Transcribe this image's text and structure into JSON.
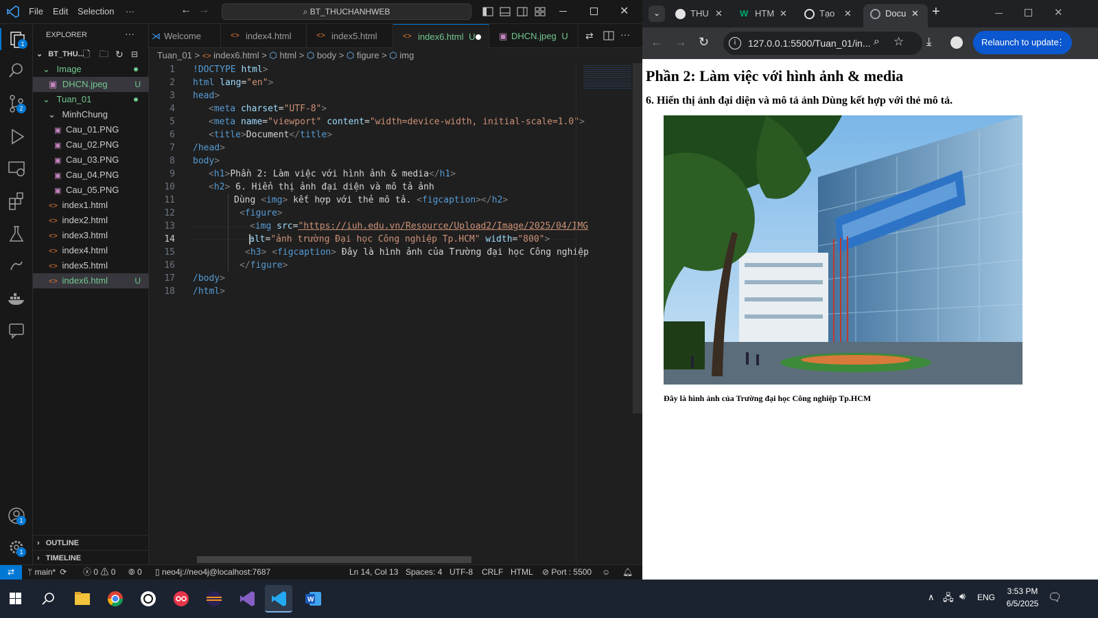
{
  "vscode": {
    "menu": [
      "File",
      "Edit",
      "Selection",
      "···"
    ],
    "command_center": "BT_THUCHANHWEB",
    "badges": {
      "explorer": "1",
      "source_control": "2",
      "accounts": "1",
      "manage": "1"
    },
    "explorer": {
      "title": "EXPLORER",
      "more": "···",
      "root": "BT_THU...",
      "items": [
        {
          "label": "Image",
          "status": ""
        },
        {
          "label": "DHCN.jpeg",
          "status": "U"
        },
        {
          "label": "Tuan_01",
          "status": ""
        },
        {
          "label": "MinhChung",
          "status": ""
        },
        {
          "label": "Cau_01.PNG",
          "status": ""
        },
        {
          "label": "Cau_02.PNG",
          "status": ""
        },
        {
          "label": "Cau_03.PNG",
          "status": ""
        },
        {
          "label": "Cau_04.PNG",
          "status": ""
        },
        {
          "label": "Cau_05.PNG",
          "status": ""
        },
        {
          "label": "index1.html",
          "status": ""
        },
        {
          "label": "index2.html",
          "status": ""
        },
        {
          "label": "index3.html",
          "status": ""
        },
        {
          "label": "index4.html",
          "status": ""
        },
        {
          "label": "index5.html",
          "status": ""
        },
        {
          "label": "index6.html",
          "status": "U"
        }
      ],
      "outline": "OUTLINE",
      "timeline": "TIMELINE"
    },
    "tabs": [
      {
        "label": "Welcome",
        "status": ""
      },
      {
        "label": "index4.html",
        "status": ""
      },
      {
        "label": "index5.html",
        "status": ""
      },
      {
        "label": "index6.html",
        "status": "U"
      },
      {
        "label": "DHCN.jpeg",
        "status": "U"
      }
    ],
    "breadcrumbs": [
      "Tuan_01",
      ">",
      "index6.html",
      ">",
      "html",
      ">",
      "body",
      ">",
      "figure",
      ">",
      "img"
    ],
    "code": {
      "line_numbers": [
        "1",
        "2",
        "3",
        "4",
        "5",
        "6",
        "7",
        "8",
        "9",
        "10",
        "11",
        "12",
        "13",
        "14",
        "15",
        "16",
        "17",
        "18"
      ],
      "current_line": "14",
      "l1_a": "!DOCTYPE",
      "l1_b": " html",
      "l1_c": ">",
      "l2_a": "html",
      "l2_b": " lang",
      "l2_c": "=",
      "l2_d": "\"en\"",
      "l2_e": ">",
      "l3_a": "head",
      "l3_b": ">",
      "l4_a": "<",
      "l4_b": "meta",
      "l4_c": " charset",
      "l4_d": "=",
      "l4_e": "\"UTF-8\"",
      "l4_f": ">",
      "l5_a": "<",
      "l5_b": "meta",
      "l5_c": " name",
      "l5_d": "=",
      "l5_e": "\"viewport\"",
      "l5_f": " content",
      "l5_g": "=",
      "l5_h": "\"width=device-width, initial-scale=1.0\"",
      "l5_i": ">",
      "l6_a": "<",
      "l6_b": "title",
      "l6_c": ">",
      "l6_d": "Document",
      "l6_e": "</",
      "l6_f": "title",
      "l6_g": ">",
      "l7_a": "/head",
      "l7_b": ">",
      "l8_a": "body",
      "l8_b": ">",
      "l9_a": "<",
      "l9_b": "h1",
      "l9_c": ">",
      "l9_d": "Phần 2: Làm việc với hình ảnh & media",
      "l9_e": "</",
      "l9_f": "h1",
      "l9_g": ">",
      "l10_a": "<",
      "l10_b": "h2",
      "l10_c": ">",
      "l10_d": " 6. Hiển thị ảnh đại diện và mô tả ảnh",
      "l11_a": "Dùng ",
      "l11_b": "<",
      "l11_c": "img",
      "l11_d": ">",
      "l11_e": " kết hợp với thẻ mô tả. ",
      "l11_f": "<",
      "l11_g": "figcaption",
      "l11_h": "></",
      "l11_i": "h2",
      "l11_j": ">",
      "l12_a": "<",
      "l12_b": "figure",
      "l12_c": ">",
      "l13_a": "<",
      "l13_b": "img",
      "l13_c": " src",
      "l13_d": "=",
      "l13_e": "\"https://iuh.edu.vn/Resource/Upload2/Image/2025/04/IMG",
      "l14_a": "alt",
      "l14_b": "=",
      "l14_c": "\"ảnh trường Đại học Công nghiệp Tp.HCM\"",
      "l14_d": " width",
      "l14_e": "=",
      "l14_f": "\"800\"",
      "l14_g": ">",
      "l15_a": "<",
      "l15_b": "h3",
      "l15_c": ">",
      "l15_d": " ",
      "l15_e": "<",
      "l15_f": "figcaption",
      "l15_g": ">",
      "l15_h": " Đây là hình ảnh của Trường đại học Công nghiệp",
      "l16_a": "</",
      "l16_b": "figure",
      "l16_c": ">",
      "l17_a": "/body",
      "l17_b": ">",
      "l18_a": "/html",
      "l18_b": ">"
    },
    "status": {
      "branch": "main*",
      "errors": "0",
      "warnings": "0",
      "ports": "0",
      "db": "neo4j://neo4j@localhost:7687",
      "cursor": "Ln 14, Col 13",
      "spaces": "Spaces: 4",
      "encoding": "UTF-8",
      "eol": "CRLF",
      "language": "HTML",
      "port": "Port : 5500"
    }
  },
  "chrome": {
    "tabs": [
      {
        "label": "THU",
        "icon": "github-icon"
      },
      {
        "label": "HTM",
        "icon": "w3-icon"
      },
      {
        "label": "Tạo",
        "icon": "openai-icon"
      },
      {
        "label": "Docu",
        "icon": "globe-icon"
      }
    ],
    "url": "127.0.0.1:5500/Tuan_01/in...",
    "relaunch": "Relaunch to update",
    "page": {
      "h1": "Phần 2: Làm việc với hình ảnh & media",
      "h2": "6. Hiển thị ảnh đại diện và mô tả ảnh Dùng  kết hợp với thẻ mô tả.",
      "caption": "Đây là hình ảnh của Trường đại học Công nghiệp Tp.HCM"
    }
  },
  "taskbar": {
    "lang": "ENG",
    "time": "3:53 PM",
    "date": "6/5/2025"
  },
  "colors": {
    "accent": "#0078d4",
    "untracked": "#73c991",
    "chrome_button": "#0b57d0"
  }
}
